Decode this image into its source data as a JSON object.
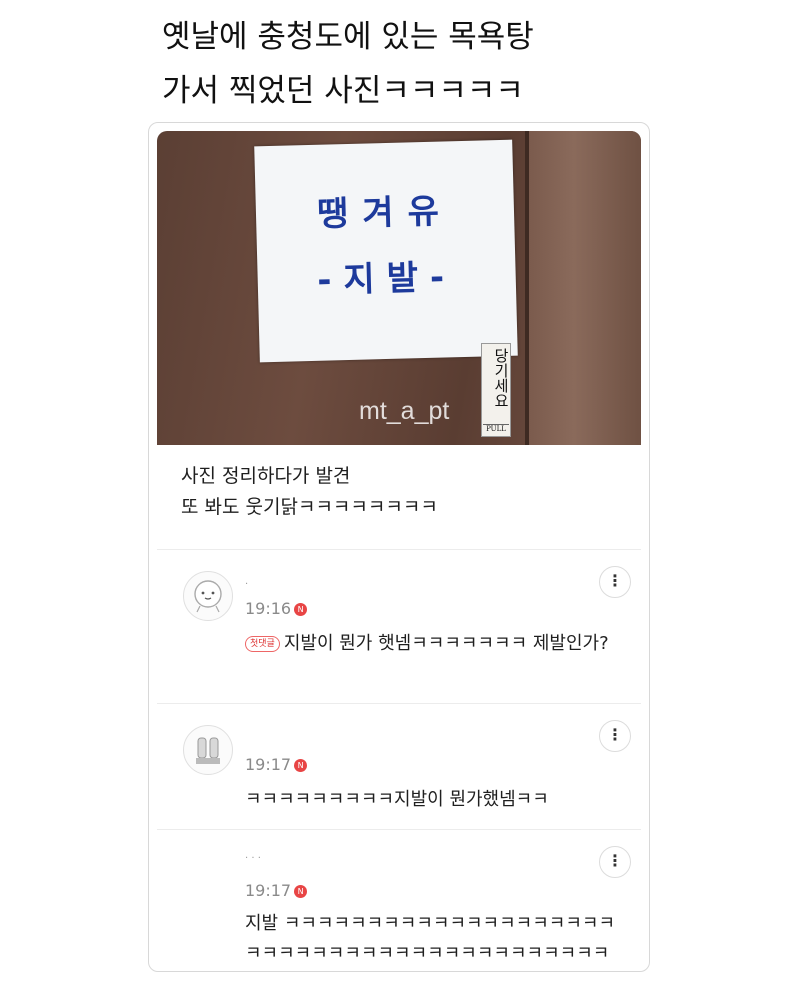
{
  "headline": {
    "line1": "옛날에 충청도에 있는 목욕탕",
    "line2": "가서 찍었던 사진ㅋㅋㅋㅋㅋ"
  },
  "post": {
    "photo": {
      "notice_line1": "땡겨유",
      "notice_line2": "-지발-",
      "pull_sign_korean": "당기세요",
      "pull_sign_english": "PULL",
      "watermark": "mt_a_pt"
    },
    "caption_line1": "사진 정리하다가 발견",
    "caption_line2": "또 봐도 웃기닭ㅋㅋㅋㅋㅋㅋㅋㅋ"
  },
  "comments": [
    {
      "author": "·",
      "time": "19:16",
      "badge": "N",
      "first_tag": "첫댓글",
      "text": "지발이 뭔가 햇넴ㅋㅋㅋㅋㅋㅋㅋ 제발인가?",
      "more_icon": "more-vertical-icon"
    },
    {
      "author": "",
      "time": "19:17",
      "badge": "N",
      "text": "ㅋㅋㅋㅋㅋㅋㅋㅋㅋ지발이 뭔가했넴ㅋㅋ",
      "more_icon": "more-vertical-icon"
    },
    {
      "author": "· · ·",
      "time": "19:17",
      "badge": "N",
      "text": "지발 ㅋㅋㅋㅋㅋㅋㅋㅋㅋㅋㅋㅋㅋㅋㅋㅋㅋㅋㅋㅋㅋㅋㅋㅋㅋㅋㅋㅋㅋㅋㅋㅋㅋㅋㅋㅋㅋㅋㅋㅋㅋㅋ",
      "more_icon": "more-vertical-icon"
    }
  ],
  "colors": {
    "notice_text": "#1d3a9c",
    "new_badge": "#e84545",
    "time_text": "#8a8a8a"
  }
}
